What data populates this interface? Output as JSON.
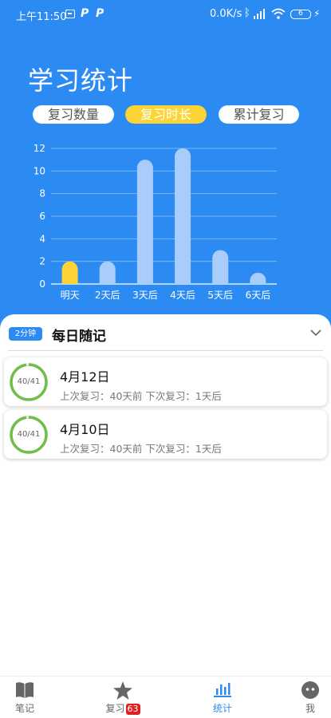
{
  "status_bar": {
    "time": "上午11:50",
    "p_icon": "P",
    "speed": "0.0K/s",
    "battery": "6",
    "bluetooth": "ᛒ",
    "charge": "⚡"
  },
  "page_title": "学习统计",
  "tabs": [
    {
      "label": "复习数量",
      "active": false
    },
    {
      "label": "复习时长",
      "active": true
    },
    {
      "label": "累计复习",
      "active": false
    }
  ],
  "chart_data": {
    "type": "bar",
    "categories": [
      "明天",
      "2天后",
      "3天后",
      "4天后",
      "5天后",
      "6天后"
    ],
    "values": [
      2,
      2,
      11,
      12,
      3,
      1
    ],
    "ylim": [
      0,
      12
    ],
    "yticks": [
      0,
      2,
      4,
      6,
      8,
      10,
      12
    ],
    "grid": true,
    "highlight_index": 0,
    "colors": {
      "highlight": "#fdd435",
      "bar": "#a9cdfa",
      "grid": "#7db4f5",
      "text": "#ffffff"
    }
  },
  "deck": {
    "badge": "2分钟",
    "title": "每日随记"
  },
  "notes": [
    {
      "progress_text": "40/41",
      "progress": 0.976,
      "date": "4月12日",
      "meta": "上次复习：40天前 下次复习：1天后"
    },
    {
      "progress_text": "40/41",
      "progress": 0.976,
      "date": "4月10日",
      "meta": "上次复习：40天前 下次复习：1天后"
    }
  ],
  "nav": [
    {
      "label": "笔记",
      "icon": "book-icon",
      "active": false
    },
    {
      "label": "复习",
      "icon": "star-icon",
      "active": false,
      "badge": "63"
    },
    {
      "label": "统计",
      "icon": "bar-chart-icon",
      "active": true
    },
    {
      "label": "我",
      "icon": "face-icon",
      "active": false
    }
  ],
  "colors": {
    "brand": "#2b8bf2",
    "accent": "#fdd435",
    "progress": "#6fbe4a"
  }
}
